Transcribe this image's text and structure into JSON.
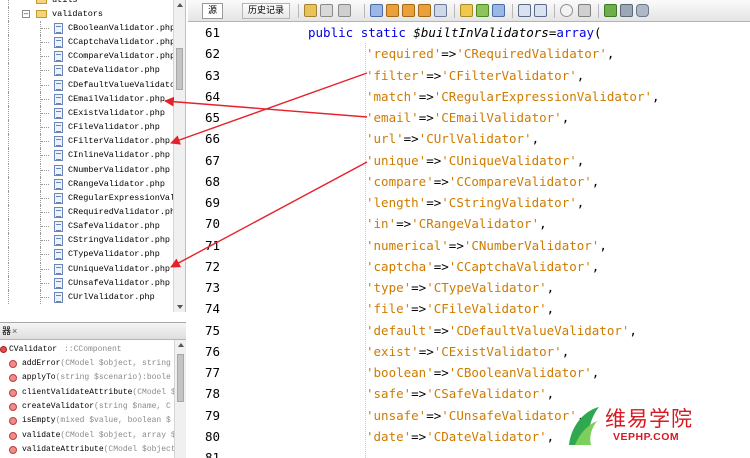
{
  "tree": {
    "folder_partial": "utils",
    "folder": "validators",
    "files": [
      "CBooleanValidator.php",
      "CCaptchaValidator.php",
      "CCompareValidator.php",
      "CDateValidator.php",
      "CDefaultValueValidator",
      "CEmailValidator.php",
      "CExistValidator.php",
      "CFileValidator.php",
      "CFilterValidator.php",
      "CInlineValidator.php",
      "CNumberValidator.php",
      "CRangeValidator.php",
      "CRegularExpressionVali",
      "CRequiredValidator.php",
      "CSafeValidator.php",
      "CStringValidator.php",
      "CTypeValidator.php",
      "CUniqueValidator.php",
      "CUnsafeValidator.php",
      "CUrlValidator.php"
    ]
  },
  "navigator": {
    "tab_title": "器",
    "tab_close": "×",
    "class_name": "CValidator",
    "class_parent": "::CComponent",
    "methods": [
      {
        "name": "addError",
        "params": "(CModel $object, string"
      },
      {
        "name": "applyTo",
        "params": "(string $scenario):boole"
      },
      {
        "name": "clientValidateAttribute",
        "params": "(CModel $"
      },
      {
        "name": "createValidator",
        "params": "(string $name, C"
      },
      {
        "name": "isEmpty",
        "params": "(mixed $value, boolean $"
      },
      {
        "name": "validate",
        "params": "(CModel $object, array $"
      },
      {
        "name": "validateAttribute",
        "params": "(CModel $object"
      }
    ]
  },
  "toolbar": {
    "source_tab": "源",
    "history_tab": "历史记录"
  },
  "editor": {
    "line_numbers": [
      "61",
      "62",
      "63",
      "64",
      "65",
      "66",
      "67",
      "68",
      "69",
      "70",
      "71",
      "72",
      "73",
      "74",
      "75",
      "76",
      "77",
      "78",
      "79",
      "80",
      "81"
    ],
    "first_line": {
      "kw1": "public",
      "kw2": "static",
      "var": "$builtInValidators",
      "eq": "=",
      "fn": "array",
      "paren": "("
    },
    "entries": [
      {
        "key": "'required'",
        "value": "'CRequiredValidator'"
      },
      {
        "key": "'filter'",
        "value": "'CFilterValidator'"
      },
      {
        "key": "'match'",
        "value": "'CRegularExpressionValidator'"
      },
      {
        "key": "'email'",
        "value": "'CEmailValidator'"
      },
      {
        "key": "'url'",
        "value": "'CUrlValidator'"
      },
      {
        "key": "'unique'",
        "value": "'CUniqueValidator'"
      },
      {
        "key": "'compare'",
        "value": "'CCompareValidator'"
      },
      {
        "key": "'length'",
        "value": "'CStringValidator'"
      },
      {
        "key": "'in'",
        "value": "'CRangeValidator'"
      },
      {
        "key": "'numerical'",
        "value": "'CNumberValidator'"
      },
      {
        "key": "'captcha'",
        "value": "'CCaptchaValidator'"
      },
      {
        "key": "'type'",
        "value": "'CTypeValidator'"
      },
      {
        "key": "'file'",
        "value": "'CFileValidator'"
      },
      {
        "key": "'default'",
        "value": "'CDefaultValueValidator'"
      },
      {
        "key": "'exist'",
        "value": "'CExistValidator'"
      },
      {
        "key": "'boolean'",
        "value": "'CBooleanValidator'"
      },
      {
        "key": "'safe'",
        "value": "'CSafeValidator'"
      },
      {
        "key": "'unsafe'",
        "value": "'CUnsafeValidator'"
      },
      {
        "key": "'date'",
        "value": "'CDateValidator'"
      }
    ],
    "arrow_op": "=>",
    "sep": ","
  },
  "annotation_color": "#e8202a",
  "watermark": {
    "title": "维易学院",
    "subtitle": "VEPHP.COM"
  }
}
